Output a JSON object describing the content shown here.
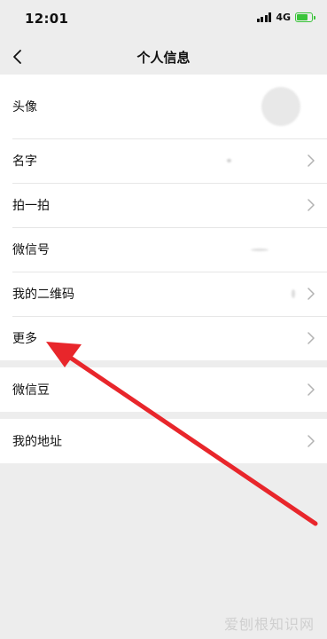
{
  "status_bar": {
    "time": "12:01",
    "network": "4G"
  },
  "nav": {
    "title": "个人信息"
  },
  "groups": [
    {
      "items": [
        {
          "label": "头像"
        },
        {
          "label": "名字"
        },
        {
          "label": "拍一拍"
        },
        {
          "label": "微信号"
        },
        {
          "label": "我的二维码"
        },
        {
          "label": "更多"
        }
      ]
    },
    {
      "items": [
        {
          "label": "微信豆"
        }
      ]
    },
    {
      "items": [
        {
          "label": "我的地址"
        }
      ]
    }
  ],
  "overlay": {
    "arrow_color": "#e8262b"
  },
  "watermark": {
    "text": "爱刨根知识网"
  }
}
